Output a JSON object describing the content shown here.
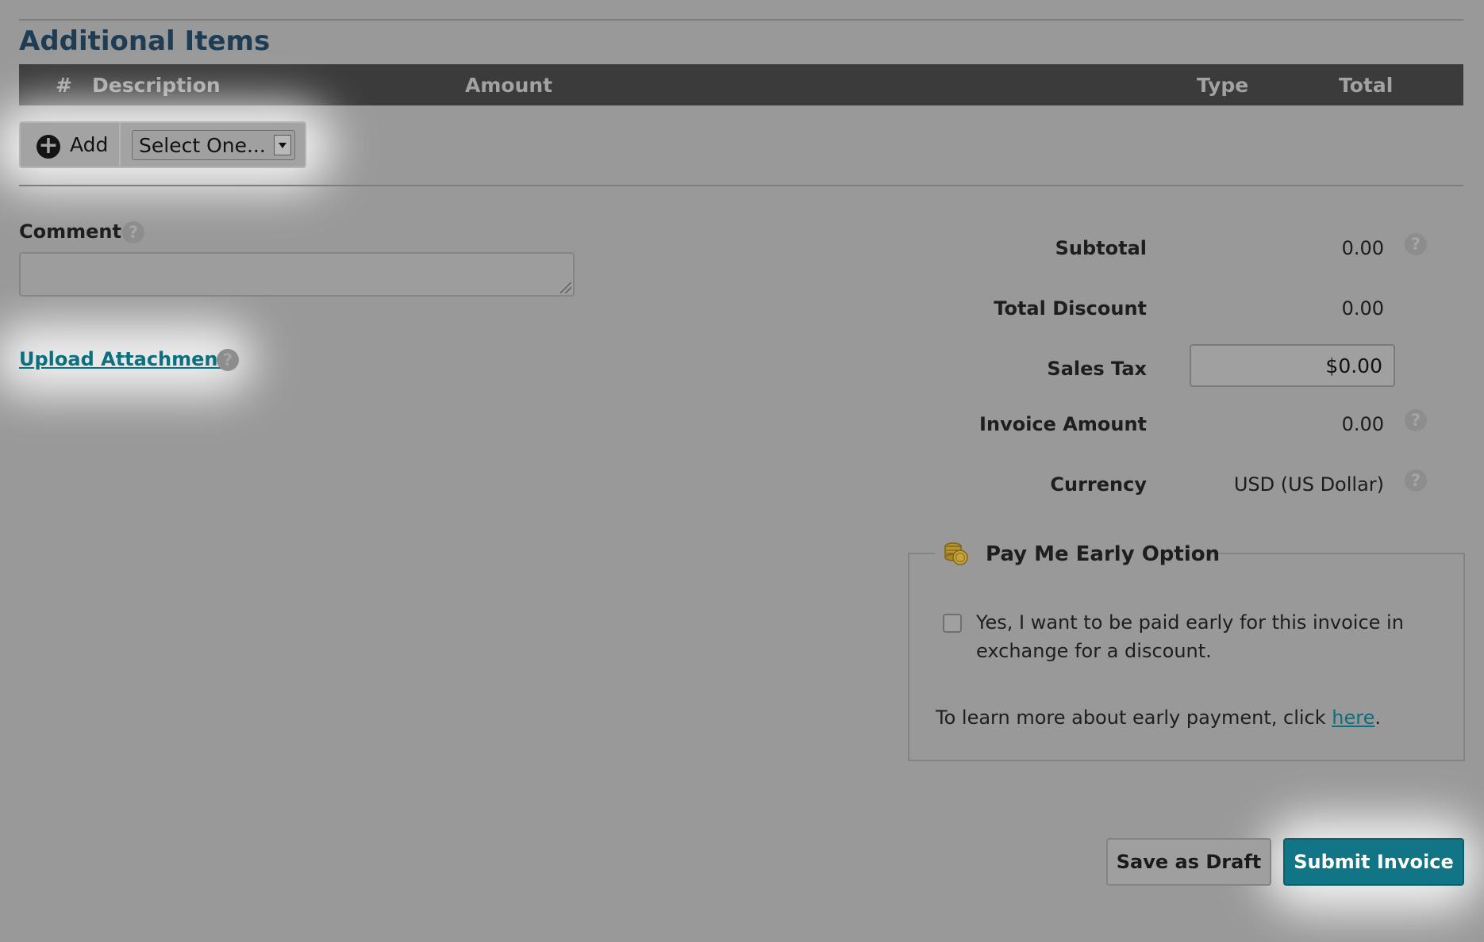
{
  "section_title": "Additional Items",
  "table": {
    "columns": [
      "#",
      "Description",
      "Amount",
      "Type",
      "Total"
    ]
  },
  "add_control": {
    "add_label": "Add",
    "select_value": "Select One..."
  },
  "comment": {
    "label": "Comment",
    "value": "",
    "help_glyph": "?"
  },
  "upload": {
    "link_text": "Upload Attachment",
    "help_glyph": "?"
  },
  "summary": {
    "subtotal_label": "Subtotal",
    "subtotal_value": "0.00",
    "discount_label": "Total Discount",
    "discount_value": "0.00",
    "tax_label": "Sales Tax",
    "tax_value": "$0.00",
    "invoice_label": "Invoice Amount",
    "invoice_value": "0.00",
    "currency_label": "Currency",
    "currency_value": "USD (US Dollar)",
    "help_glyph": "?"
  },
  "pay_early": {
    "title": "Pay Me Early Option",
    "checkbox_text": "Yes, I want to be paid early for this invoice in exchange for a discount.",
    "checked": false,
    "learn_prefix": "To learn more about early payment, click ",
    "learn_link": "here",
    "learn_suffix": "."
  },
  "actions": {
    "draft_label": "Save as Draft",
    "submit_label": "Submit Invoice"
  },
  "colors": {
    "overlay_bg": "#999999",
    "accent": "#117585",
    "link": "#0d6e7e",
    "title": "#1e3d54",
    "table_header": "#3b3b3b",
    "highlight_glow": "#ffffff"
  },
  "icons": {
    "add": "plus-circle-icon",
    "pay_early": "coins-icon",
    "help": "question-circle-icon",
    "select": "chevron-down-icon"
  }
}
